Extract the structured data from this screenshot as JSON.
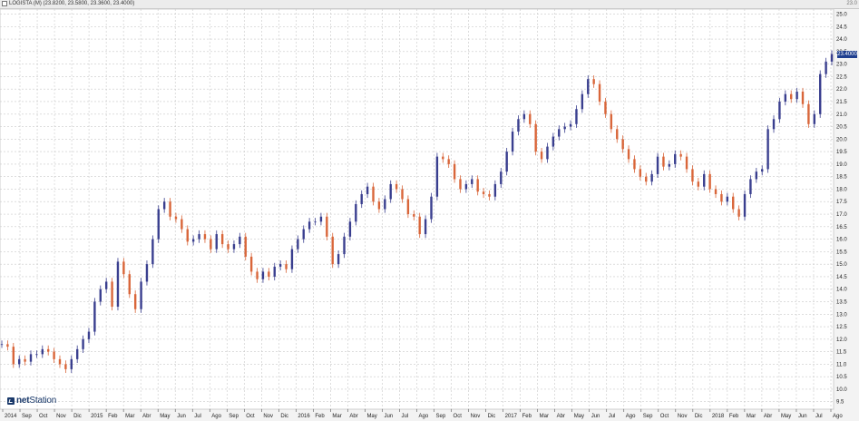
{
  "window": {
    "title": "LOGISTA (M) (23.8200, 23.5800, 23.3600, 23.4000)",
    "corner_label": "23.0"
  },
  "logo": {
    "prefix": "net",
    "suffix": "Station"
  },
  "last_price_label": "23.4000",
  "colors": {
    "up": "#3a3f8f",
    "down": "#d9663a",
    "grid": "#c9c9c9",
    "price_tag": "#1f3f8f"
  },
  "chart_data": {
    "type": "line",
    "title": "",
    "xlabel": "",
    "ylabel": "",
    "ylim": [
      9.2,
      25.2
    ],
    "y_ticks": [
      "25.0",
      "24.5",
      "24.0",
      "23.5",
      "23.0",
      "22.5",
      "22.0",
      "21.5",
      "21.0",
      "20.5",
      "20.0",
      "19.5",
      "19.0",
      "18.5",
      "18.0",
      "17.5",
      "17.0",
      "16.5",
      "16.0",
      "15.5",
      "15.0",
      "14.5",
      "14.0",
      "13.5",
      "13.0",
      "12.5",
      "12.0",
      "11.5",
      "11.0",
      "10.5",
      "10.0",
      "9.5"
    ],
    "x_ticks": [
      "2014",
      "Sep",
      "Oct",
      "Nov",
      "Dic",
      "2015",
      "Feb",
      "Mar",
      "Abr",
      "May",
      "Jun",
      "Jul",
      "Ago",
      "Sep",
      "Oct",
      "Nov",
      "Dic",
      "2016",
      "Feb",
      "Mar",
      "Abr",
      "May",
      "Jun",
      "Jul",
      "Ago",
      "Sep",
      "Oct",
      "Nov",
      "Dic",
      "2017",
      "Feb",
      "Mar",
      "Abr",
      "May",
      "Jun",
      "Jul",
      "Ago",
      "Sep",
      "Oct",
      "Nov",
      "Dic",
      "2018",
      "Feb",
      "Mar",
      "Abr",
      "May",
      "Jun",
      "Jul",
      "Ago"
    ],
    "grid": true,
    "series": [
      {
        "values": [
          11.8,
          11.7,
          11.0,
          11.2,
          11.1,
          11.4,
          11.4,
          11.6,
          11.5,
          11.2,
          11.0,
          10.8,
          11.2,
          11.6,
          12.0,
          12.3,
          13.5,
          14.0,
          14.3,
          13.3,
          15.1,
          14.6,
          13.8,
          13.2,
          14.3,
          15.0,
          16.0,
          17.2,
          17.5,
          16.9,
          16.8,
          16.4,
          15.9,
          16.0,
          16.2,
          16.0,
          15.6,
          16.2,
          15.8,
          15.6,
          15.8,
          16.1,
          15.3,
          14.7,
          14.4,
          14.7,
          14.5,
          14.9,
          15.0,
          14.8,
          15.6,
          16.0,
          16.4,
          16.7,
          16.7,
          16.9,
          16.1,
          15.0,
          15.4,
          16.1,
          16.7,
          17.4,
          17.8,
          18.1,
          17.5,
          17.2,
          17.6,
          18.2,
          18.0,
          17.6,
          17.0,
          16.9,
          16.2,
          16.8,
          17.7,
          19.3,
          19.2,
          19.0,
          18.4,
          18.0,
          18.2,
          18.4,
          17.9,
          17.8,
          17.7,
          18.2,
          18.7,
          19.5,
          20.3,
          20.8,
          21.0,
          20.6,
          19.5,
          19.2,
          19.7,
          20.1,
          20.4,
          20.5,
          20.6,
          21.2,
          21.8,
          22.4,
          22.2,
          21.5,
          21.0,
          20.4,
          20.0,
          19.6,
          19.2,
          18.8,
          18.5,
          18.3,
          18.6,
          19.3,
          18.9,
          19.0,
          19.4,
          19.3,
          18.8,
          18.3,
          18.1,
          18.6,
          18.0,
          17.8,
          17.5,
          17.7,
          17.2,
          16.9,
          17.8,
          18.4,
          18.7,
          18.8,
          20.4,
          20.8,
          21.5,
          21.8,
          21.6,
          21.9,
          21.4,
          20.6,
          21.0,
          22.6,
          23.1,
          23.4
        ]
      }
    ]
  }
}
